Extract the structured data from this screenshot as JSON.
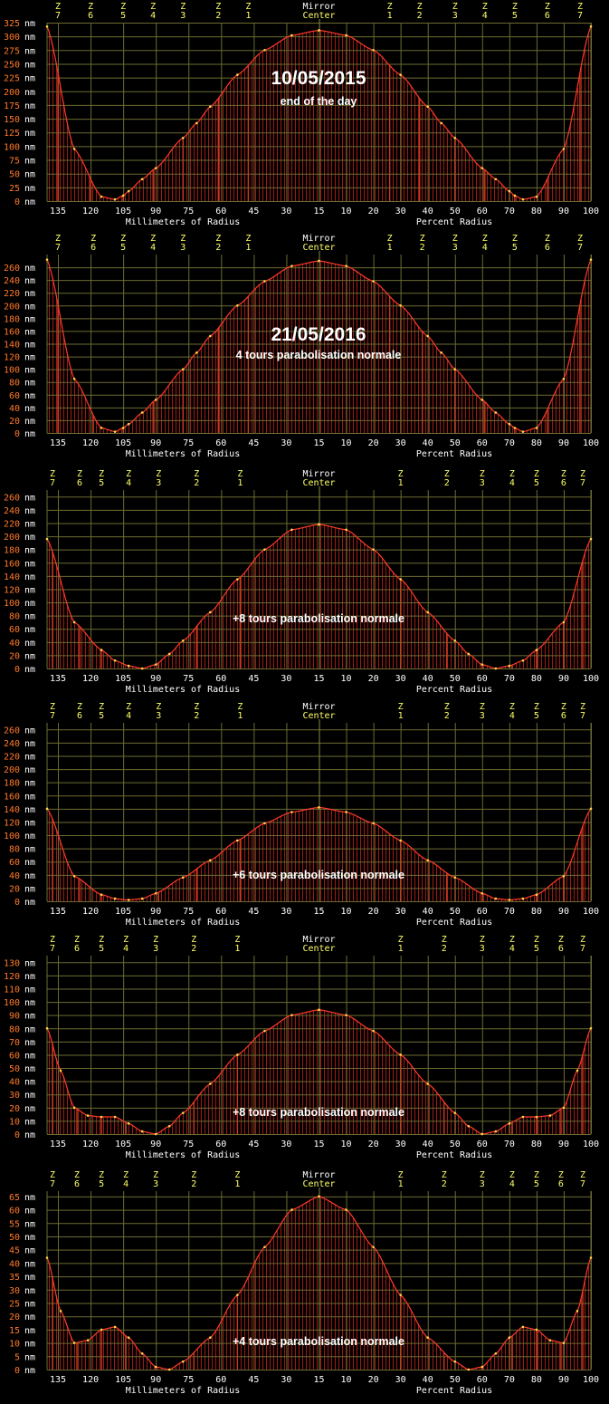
{
  "colors": {
    "background": "#000000",
    "grid": "#6b6b33",
    "center_line": "#8a8a40",
    "fill_lines": "#9e1a12",
    "curve": "#ff3a2a",
    "zone_marker": "#ffd84a",
    "zone_label": "#ffff66",
    "y_label_number": "#ff7a2a",
    "y_label_unit": "#ffffff",
    "axis_text": "#ffffff",
    "caption": "#ffffff"
  },
  "chart_data": [
    {
      "type": "area",
      "date": "10/05/2015",
      "caption": "end of the day",
      "yunit": "nm",
      "yticks": [
        0,
        25,
        50,
        75,
        100,
        125,
        150,
        175,
        200,
        225,
        250,
        275,
        300,
        325
      ],
      "ylim": [
        0,
        325
      ],
      "x_left_label": "Millimeters of Radius",
      "x_right_label": "Percent Radius",
      "x_left_ticks": [
        "135",
        "120",
        "105",
        "90",
        "75",
        "60",
        "45",
        "30",
        "15"
      ],
      "x_right_ticks": [
        "10",
        "20",
        "30",
        "40",
        "50",
        "60",
        "70",
        "80",
        "90",
        "100"
      ],
      "center_label": [
        "Mirror",
        "Center"
      ],
      "zones_left": [
        "7",
        "6",
        "5",
        "4",
        "3",
        "2",
        "1"
      ],
      "zones_right": [
        "1",
        "2",
        "3",
        "4",
        "5",
        "6",
        "7"
      ],
      "x": [
        0,
        10,
        20,
        30,
        40,
        45,
        50,
        60,
        65,
        70,
        72,
        75,
        80,
        90,
        100
      ],
      "y": [
        311,
        302,
        275,
        230,
        172,
        142,
        115,
        60,
        40,
        18,
        10,
        3,
        8,
        95,
        318
      ]
    },
    {
      "type": "area",
      "date": "21/05/2016",
      "caption": "4 tours parabolisation normale",
      "yunit": "nm",
      "yticks": [
        0,
        20,
        40,
        60,
        80,
        100,
        120,
        140,
        160,
        180,
        200,
        220,
        240,
        260
      ],
      "ylim": [
        0,
        280
      ],
      "x_left_label": "Millimeters of Radius",
      "x_right_label": "Percent Radius",
      "x_left_ticks": [
        "135",
        "120",
        "105",
        "90",
        "75",
        "60",
        "45",
        "30",
        "15"
      ],
      "x_right_ticks": [
        "10",
        "20",
        "30",
        "40",
        "50",
        "60",
        "70",
        "80",
        "90",
        "100"
      ],
      "center_label": [
        "Mirror",
        "Center"
      ],
      "zones_left": [
        "7",
        "6",
        "5",
        "4",
        "3",
        "2",
        "1"
      ],
      "zones_right": [
        "1",
        "2",
        "3",
        "4",
        "5",
        "6",
        "7"
      ],
      "x": [
        0,
        10,
        20,
        30,
        40,
        45,
        50,
        60,
        65,
        70,
        72,
        75,
        80,
        90,
        100
      ],
      "y": [
        270,
        262,
        238,
        200,
        152,
        126,
        100,
        52,
        32,
        14,
        8,
        2,
        8,
        85,
        272
      ]
    },
    {
      "type": "area",
      "date": "",
      "caption": "+8  tours parabolisation normale",
      "yunit": "nm",
      "yticks": [
        0,
        20,
        40,
        60,
        80,
        100,
        120,
        140,
        160,
        180,
        200,
        220,
        240,
        260
      ],
      "ylim": [
        0,
        270
      ],
      "x_left_label": "Millimeters of Radius",
      "x_right_label": "Percent Radius",
      "x_left_ticks": [
        "135",
        "120",
        "105",
        "90",
        "75",
        "60",
        "45",
        "30",
        "15"
      ],
      "x_right_ticks": [
        "10",
        "20",
        "30",
        "40",
        "50",
        "60",
        "70",
        "80",
        "90",
        "100"
      ],
      "center_label": [
        "Mirror",
        "Center"
      ],
      "zones_left": [
        "7",
        "6",
        "5",
        "4",
        "3",
        "2",
        "1"
      ],
      "zones_right": [
        "1",
        "2",
        "3",
        "4",
        "5",
        "6",
        "7"
      ],
      "x": [
        0,
        10,
        20,
        30,
        40,
        50,
        55,
        60,
        65,
        70,
        75,
        80,
        90,
        100
      ],
      "y": [
        218,
        210,
        180,
        135,
        85,
        42,
        22,
        6,
        0,
        4,
        12,
        28,
        70,
        196
      ]
    },
    {
      "type": "area",
      "date": "",
      "caption": "+6  tours parabolisation normale",
      "yunit": "nm",
      "yticks": [
        0,
        20,
        40,
        60,
        80,
        100,
        120,
        140,
        160,
        180,
        200,
        220,
        240,
        260
      ],
      "ylim": [
        0,
        270
      ],
      "x_left_label": "Millimeters of Radius",
      "x_right_label": "Percent Radius",
      "x_left_ticks": [
        "135",
        "120",
        "105",
        "90",
        "75",
        "60",
        "45",
        "30",
        "15"
      ],
      "x_right_ticks": [
        "10",
        "20",
        "30",
        "40",
        "50",
        "60",
        "70",
        "80",
        "90",
        "100"
      ],
      "center_label": [
        "Mirror",
        "Center"
      ],
      "zones_left": [
        "7",
        "6",
        "5",
        "4",
        "3",
        "2",
        "1"
      ],
      "zones_right": [
        "1",
        "2",
        "3",
        "4",
        "5",
        "6",
        "7"
      ],
      "x": [
        0,
        10,
        20,
        30,
        40,
        50,
        60,
        65,
        70,
        75,
        80,
        90,
        100
      ],
      "y": [
        142,
        135,
        118,
        92,
        62,
        36,
        12,
        4,
        2,
        4,
        10,
        38,
        140
      ]
    },
    {
      "type": "area",
      "date": "",
      "caption": "+8  tours parabolisation normale",
      "yunit": "nm",
      "yticks": [
        0,
        10,
        20,
        30,
        40,
        50,
        60,
        70,
        80,
        90,
        100,
        110,
        120,
        130
      ],
      "ylim": [
        0,
        135
      ],
      "x_left_label": "Millimeters of Radius",
      "x_right_label": "Percent Radius",
      "x_left_ticks": [
        "135",
        "120",
        "105",
        "90",
        "75",
        "60",
        "45",
        "30",
        "15"
      ],
      "x_right_ticks": [
        "10",
        "20",
        "30",
        "40",
        "50",
        "60",
        "70",
        "80",
        "90",
        "100"
      ],
      "center_label": [
        "Mirror",
        "Center"
      ],
      "zones_left": [
        "7",
        "6",
        "5",
        "4",
        "3",
        "2",
        "1"
      ],
      "zones_right": [
        "1",
        "2",
        "3",
        "4",
        "5",
        "6",
        "7"
      ],
      "x": [
        0,
        10,
        20,
        30,
        40,
        50,
        55,
        60,
        65,
        70,
        75,
        80,
        85,
        90,
        95,
        100
      ],
      "y": [
        94,
        90,
        78,
        60,
        38,
        16,
        6,
        0,
        2,
        8,
        13,
        13,
        14,
        20,
        48,
        80
      ]
    },
    {
      "type": "area",
      "date": "",
      "caption": "+4 tours parabolisation normale",
      "yunit": "nm",
      "yticks": [
        0,
        5,
        10,
        15,
        20,
        25,
        30,
        35,
        40,
        45,
        50,
        55,
        60,
        65
      ],
      "ylim": [
        0,
        67
      ],
      "x_left_label": "Millimeters of Radius",
      "x_right_label": "Percent Radius",
      "x_left_ticks": [
        "135",
        "120",
        "105",
        "90",
        "75",
        "60",
        "45",
        "30",
        "15"
      ],
      "x_right_ticks": [
        "10",
        "20",
        "30",
        "40",
        "50",
        "60",
        "70",
        "80",
        "90",
        "100"
      ],
      "center_label": [
        "Mirror",
        "Center"
      ],
      "zones_left": [
        "7",
        "6",
        "5",
        "4",
        "3",
        "2",
        "1"
      ],
      "zones_right": [
        "1",
        "2",
        "3",
        "4",
        "5",
        "6",
        "7"
      ],
      "x": [
        0,
        10,
        20,
        30,
        40,
        50,
        55,
        60,
        65,
        70,
        75,
        80,
        85,
        90,
        95,
        100
      ],
      "y": [
        65,
        60,
        46,
        28,
        12,
        3,
        0,
        1,
        6,
        12,
        16,
        15,
        11,
        10,
        22,
        42
      ]
    }
  ]
}
